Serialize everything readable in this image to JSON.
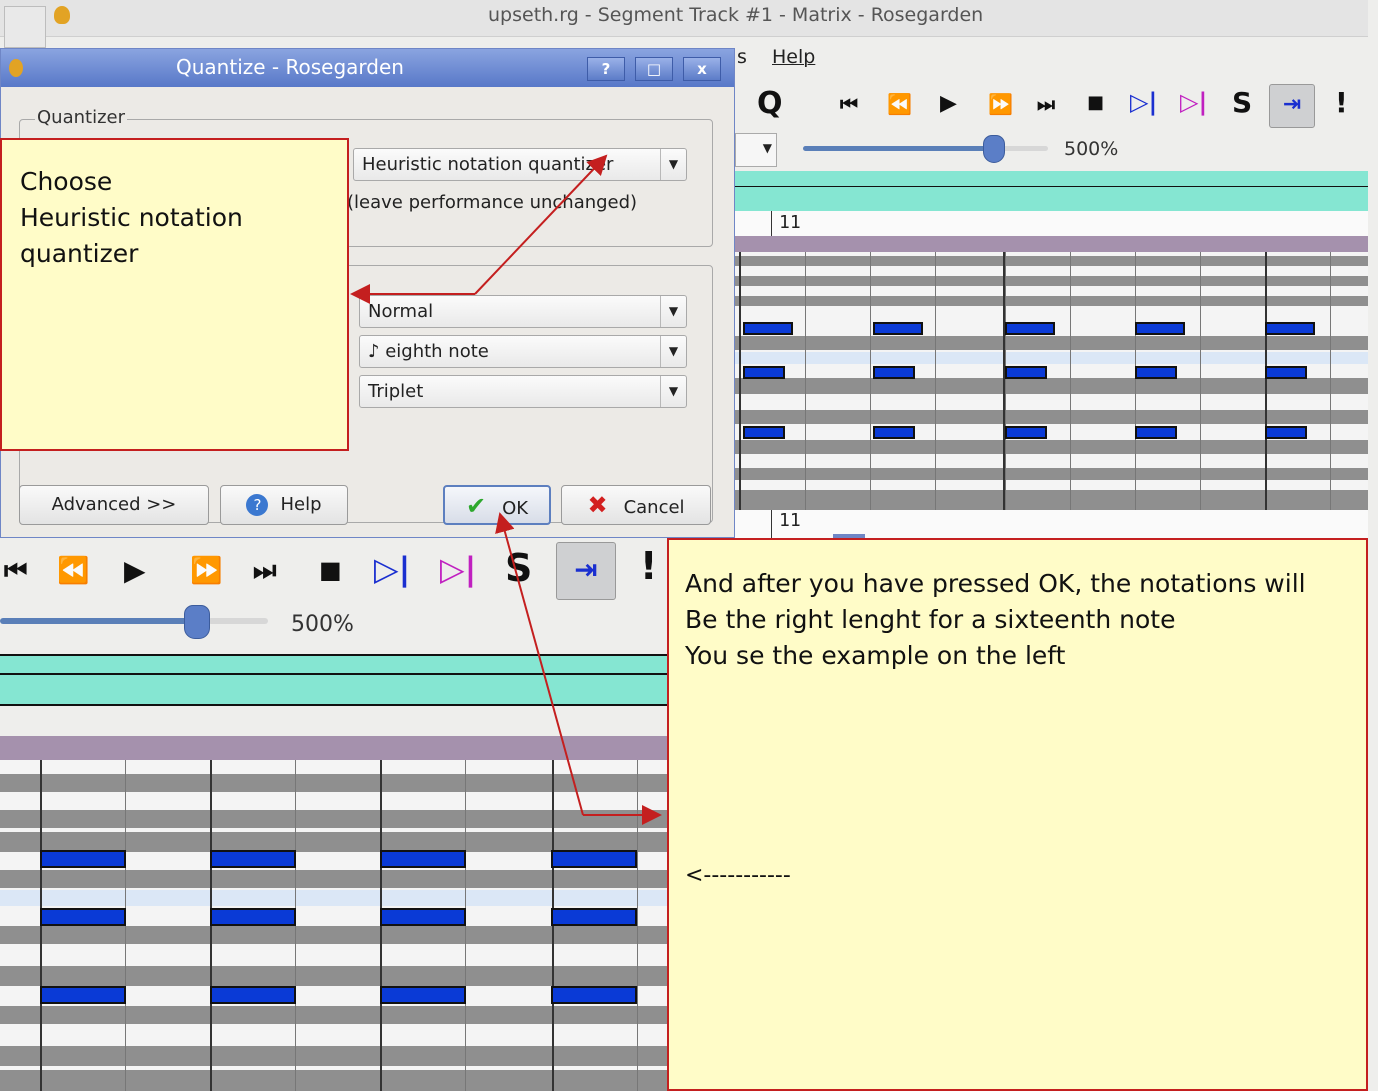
{
  "window": {
    "title": "upseth.rg - Segment Track #1 - Matrix - Rosegarden"
  },
  "menubar": {
    "items": [
      "s",
      "Help"
    ]
  },
  "toolbar": {
    "quantize_label": "Q",
    "solo_label": "S",
    "panic_label": "!",
    "zoom_value": "500%",
    "zoom_fraction": 0.8
  },
  "ruler": {
    "bar_number_top": "11",
    "bar_number_bottom": "11"
  },
  "dialog": {
    "title": "Quantize - Rosegarden",
    "titlebar_buttons": [
      "?",
      "□",
      "x"
    ],
    "quantizer_group_label": "Quantizer",
    "quantizer_type": "Heuristic notation quantizer",
    "quantizer_note": "(leave performance unchanged)",
    "complexity": "Normal",
    "base_grid": "♪ eighth note",
    "tuplet": "Triplet",
    "buttons": {
      "advanced": "Advanced >>",
      "help": "Help",
      "ok": "OK",
      "cancel": "Cancel"
    }
  },
  "annotations": {
    "left_note": "Choose\nHeuristic notation\nquantizer",
    "right_note": "And after you have pressed OK, the notations will\nBe the right lenght for a sixteenth note\nYou se the example on the left",
    "right_arrow_text": "<-----------"
  },
  "colors": {
    "note_fill": "#0a3ad6",
    "annotation_border": "#c41f1f",
    "annotation_bg": "#fffcc8",
    "dialog_titlebar": "#6a89d4",
    "segment_bar": "#85e6d2",
    "ruler_bar": "#a591ad"
  },
  "icons": {
    "toolbar": [
      "quantize-icon",
      "rewind-to-start-icon",
      "rewind-icon",
      "play-icon",
      "fast-forward-icon",
      "fast-forward-to-end-icon",
      "stop-icon",
      "loop-start-icon",
      "loop-end-icon",
      "solo-icon",
      "scroll-follow-icon",
      "panic-icon"
    ]
  }
}
